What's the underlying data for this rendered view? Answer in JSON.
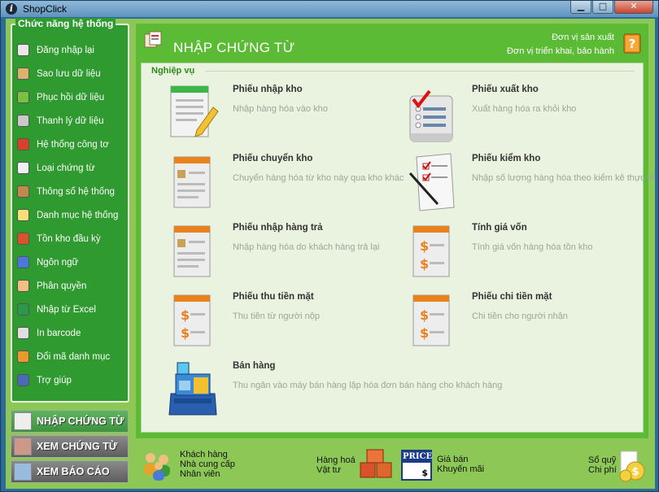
{
  "window": {
    "title": "ShopClick"
  },
  "sidebar": {
    "title": "Chức năng hệ thống",
    "items": [
      {
        "label": "Đăng nhập lại",
        "icon": "login-icon"
      },
      {
        "label": "Sao lưu dữ liệu",
        "icon": "backup-icon"
      },
      {
        "label": "Phục hồi dữ liệu",
        "icon": "restore-icon"
      },
      {
        "label": "Thanh lý dữ liệu",
        "icon": "database-icon"
      },
      {
        "label": "Hệ thống công tơ",
        "icon": "counter-icon"
      },
      {
        "label": "Loại chứng từ",
        "icon": "document-type-icon"
      },
      {
        "label": "Thông số hệ thống",
        "icon": "settings-icon"
      },
      {
        "label": "Danh mục hệ thống",
        "icon": "catalog-icon"
      },
      {
        "label": "Tồn kho đầu kỳ",
        "icon": "books-icon"
      },
      {
        "label": "Ngôn ngữ",
        "icon": "language-icon"
      },
      {
        "label": "Phân quyền",
        "icon": "permission-icon"
      },
      {
        "label": "Nhập từ Excel",
        "icon": "excel-icon"
      },
      {
        "label": "In barcode",
        "icon": "barcode-icon"
      },
      {
        "label": "Đổi mã danh mục",
        "icon": "swap-icon"
      },
      {
        "label": "Trợ giúp",
        "icon": "help-icon"
      }
    ]
  },
  "nav": {
    "active": "NHẬP CHỨNG TỪ",
    "second": "XEM CHỨNG TỪ",
    "third": "XEM BÁO CÁO"
  },
  "header": {
    "title": "NHẬP CHỨNG TỪ",
    "link1": "Đơn vị sản xuất",
    "link2": "Đơn vị triển khai, bảo hành"
  },
  "panel": {
    "title": "Nghiệp vụ",
    "tasks": [
      {
        "name": "Phiếu nhập kho",
        "desc": "Nhập hàng hóa vào kho"
      },
      {
        "name": "Phiếu xuất kho",
        "desc": "Xuất hàng hóa ra khỏi kho"
      },
      {
        "name": "Phiếu chuyển kho",
        "desc": "Chuyển hàng hóa từ kho này qua kho khác"
      },
      {
        "name": "Phiếu kiểm kho",
        "desc": "Nhập số lượng hàng hóa theo kiểm kê thực tế"
      },
      {
        "name": "Phiếu nhập hàng trả",
        "desc": "Nhập hàng hóa do khách hàng trả lại"
      },
      {
        "name": "Tính giá vốn",
        "desc": "Tính giá vốn hàng hóa tồn kho"
      },
      {
        "name": "Phiếu thu tiền mặt",
        "desc": "Thu tiền từ người nộp"
      },
      {
        "name": "Phiếu chi tiền mặt",
        "desc": "Chi tiền cho người nhận"
      },
      {
        "name": "Bán hàng",
        "desc": "Thu ngân vào máy bán hàng lập hóa đơn bán hàng cho khách hàng"
      }
    ]
  },
  "footer": {
    "partners": [
      "Khách hàng",
      "Nhà cung cấp",
      "Nhân viên"
    ],
    "goods": [
      "Hàng hoá",
      "Vật tư"
    ],
    "price": [
      "Giá bán",
      "Khuyến mãi"
    ],
    "price_tag": "PRICE",
    "price_dollar": "$",
    "ledger": [
      "Sổ quỹ",
      "Chi phí"
    ]
  }
}
